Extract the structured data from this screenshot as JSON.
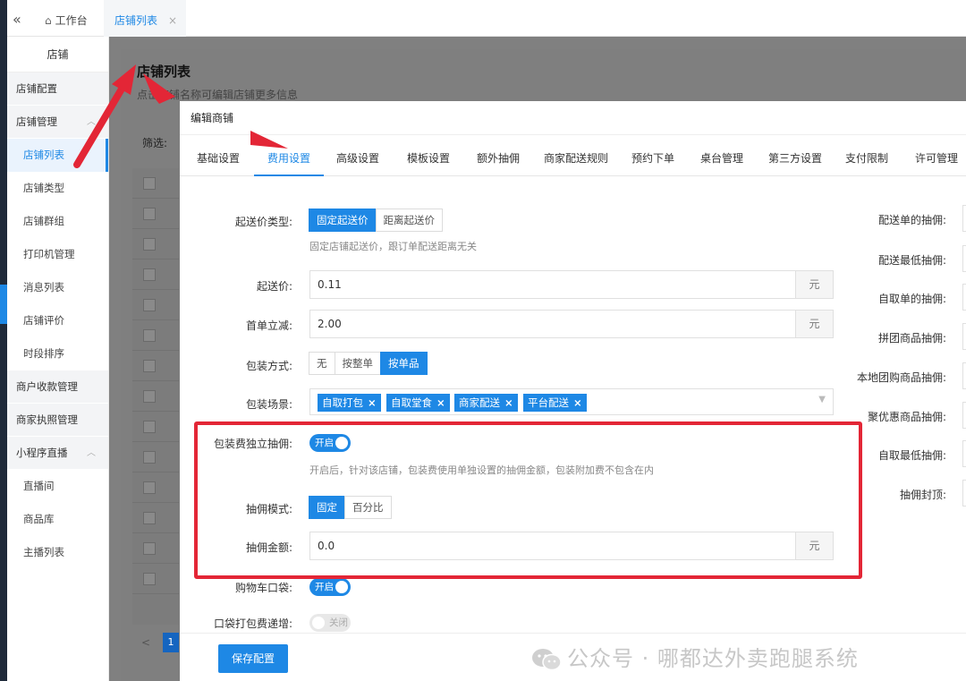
{
  "topbar": {
    "collapse_glyph": "«",
    "home_tab": "工作台",
    "active_tab": "店铺列表",
    "close_glyph": "×"
  },
  "sidebar": {
    "title": "店铺",
    "groups": [
      {
        "label": "店铺配置"
      },
      {
        "label": "店铺管理",
        "items": [
          "店铺列表",
          "店铺类型",
          "店铺群组",
          "打印机管理",
          "消息列表",
          "店铺评价",
          "时段排序"
        ]
      },
      {
        "label": "商户收款管理"
      },
      {
        "label": "商家执照管理"
      },
      {
        "label": "小程序直播",
        "items": [
          "直播间",
          "商品库",
          "主播列表"
        ]
      }
    ],
    "active_item": "店铺列表"
  },
  "page": {
    "title": "店铺列表",
    "subtitle": "点击店铺名称可编辑店铺更多信息",
    "filter_label": "筛选:",
    "pager_prev": "<",
    "pager_current": "1"
  },
  "modal": {
    "title": "编辑商铺",
    "tabs": [
      "基础设置",
      "费用设置",
      "高级设置",
      "模板设置",
      "额外抽佣",
      "商家配送规则",
      "预约下单",
      "桌台管理",
      "第三方设置",
      "支付限制",
      "许可管理"
    ],
    "active_tab": "费用设置",
    "form": {
      "min_price_type": {
        "label": "起送价类型:",
        "options": [
          "固定起送价",
          "距离起送价"
        ],
        "selected": "固定起送价",
        "hint": "固定店铺起送价，跟订单配送距离无关"
      },
      "min_price": {
        "label": "起送价:",
        "value": "0.11",
        "suffix": "元"
      },
      "first_order_discount": {
        "label": "首单立减:",
        "value": "2.00",
        "suffix": "元"
      },
      "packing_mode": {
        "label": "包装方式:",
        "options": [
          "无",
          "按整单",
          "按单品"
        ],
        "selected": "按单品"
      },
      "packing_scene": {
        "label": "包装场景:",
        "tags": [
          "自取打包",
          "自取堂食",
          "商家配送",
          "平台配送"
        ],
        "remove_glyph": "×"
      },
      "packing_commission": {
        "label": "包装费独立抽佣:",
        "switch_text": "开启",
        "hint": "开启后，针对该店铺，包装费使用单独设置的抽佣金额，包装附加费不包含在内"
      },
      "commission_mode": {
        "label": "抽佣模式:",
        "options": [
          "固定",
          "百分比"
        ],
        "selected": "固定"
      },
      "commission_amount": {
        "label": "抽佣金额:",
        "value": "0.0",
        "suffix": "元"
      },
      "cart_bag": {
        "label": "购物车口袋:",
        "switch_text": "开启"
      },
      "bag_fee_increment": {
        "label": "口袋打包费递增:",
        "switch_text": "关闭"
      }
    },
    "right_column": [
      "配送单的抽佣:",
      "配送最低抽佣:",
      "自取单的抽佣:",
      "拼团商品抽佣:",
      "本地团购商品抽佣:",
      "聚优惠商品抽佣:",
      "自取最低抽佣:",
      "抽佣封顶:"
    ],
    "save_label": "保存配置"
  },
  "watermark": "公众号 · 哪都达外卖跑腿系统",
  "colors": {
    "primary": "#1e88e5",
    "highlight_box": "#e32636",
    "arrow": "#e32636"
  }
}
